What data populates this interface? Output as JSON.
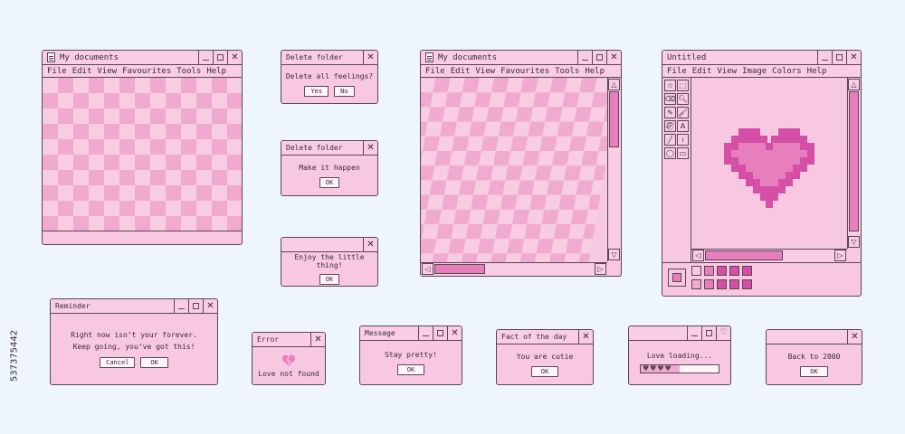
{
  "colors": {
    "pink_light": "#f8c8e2",
    "pink_mid": "#f0a9cf",
    "pink_dark": "#e77fbd",
    "heart": "#d44fa5",
    "outline": "#5a4654",
    "bg": "#eef5fc"
  },
  "doc1": {
    "title": "My documents",
    "menu": [
      "File",
      "Edit",
      "View",
      "Favourites",
      "Tools",
      "Help"
    ]
  },
  "doc2": {
    "title": "My documents",
    "menu": [
      "File",
      "Edit",
      "View",
      "Favourites",
      "Tools",
      "Help"
    ]
  },
  "paint": {
    "title": "Untitled",
    "menu": [
      "File",
      "Edit",
      "View",
      "Image",
      "Colors",
      "Help"
    ],
    "tools": [
      "☆",
      "⬚",
      "⌫",
      "🔍︎",
      "✎",
      "🖌︎",
      "🪣︎",
      "A",
      "╱",
      "≀",
      "◯",
      "▭"
    ]
  },
  "del1": {
    "title": "Delete folder",
    "message": "Delete all feelings?",
    "yes": "Yes",
    "no": "No"
  },
  "del2": {
    "title": "Delete folder",
    "message": "Make it happen",
    "ok": "OK"
  },
  "enjoy": {
    "message": "Enjoy the little thing!",
    "ok": "OK"
  },
  "reminder": {
    "title": "Reminder",
    "line1": "Right now isn’t your forever.",
    "line2": "Keep going, you’ve got this!",
    "cancel": "Cancel",
    "ok": "OK"
  },
  "error": {
    "title": "Error",
    "message": "Love not found"
  },
  "message": {
    "title": "Message",
    "text": "Stay pretty!",
    "ok": "OK"
  },
  "fact": {
    "title": "Fact of the day",
    "text": "You are cutie",
    "ok": "OK"
  },
  "loading": {
    "text": "Love loading...",
    "progress": 0.5
  },
  "back": {
    "text": "Back to 2000",
    "ok": "OK"
  },
  "watermark": {
    "id": "537375442"
  }
}
